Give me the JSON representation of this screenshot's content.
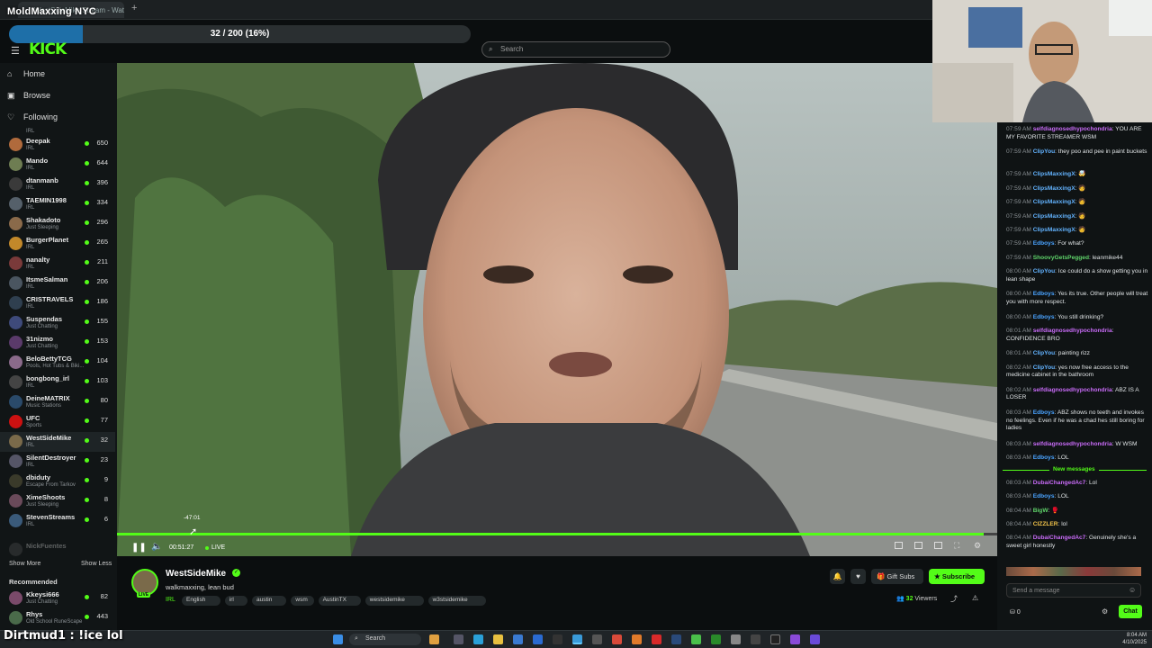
{
  "overlay": {
    "title": "MoldMaxxing NYC",
    "progress_text": "32 / 200 (16%)",
    "progress_fraction": 0.16,
    "caption": "Dirtmud1 : !ice lol"
  },
  "browser": {
    "tab_label": "WestSideMike Stream - Watc"
  },
  "header": {
    "logo": "KICK",
    "search_placeholder": "Search"
  },
  "sidebar": {
    "nav": [
      {
        "label": "Home",
        "icon": "home-icon"
      },
      {
        "label": "Browse",
        "icon": "browse-icon"
      },
      {
        "label": "Following",
        "icon": "heart-icon"
      }
    ],
    "top_partial_sub": "IRL",
    "following": [
      {
        "name": "Deepak",
        "sub": "IRL",
        "viewers": "650",
        "color": "#b06a3c"
      },
      {
        "name": "Mando",
        "sub": "IRL",
        "viewers": "644",
        "color": "#6e7d52"
      },
      {
        "name": "dtanmanb",
        "sub": "IRL",
        "viewers": "396",
        "color": "#3a3a3a"
      },
      {
        "name": "TAEMIN1998",
        "sub": "IRL",
        "viewers": "334",
        "color": "#55606a"
      },
      {
        "name": "Shakadoto",
        "sub": "Just Sleeping",
        "viewers": "296",
        "color": "#8a6a4a"
      },
      {
        "name": "BurgerPlanet",
        "sub": "IRL",
        "viewers": "265",
        "color": "#c2882a"
      },
      {
        "name": "nanalty",
        "sub": "IRL",
        "viewers": "211",
        "color": "#7a3a3a"
      },
      {
        "name": "ItsmeSalman",
        "sub": "IRL",
        "viewers": "206",
        "color": "#4a5560"
      },
      {
        "name": "CRISTRAVELS",
        "sub": "IRL",
        "viewers": "186",
        "color": "#2f3f4f"
      },
      {
        "name": "Suspendas",
        "sub": "Just Chatting",
        "viewers": "155",
        "color": "#3e4a7a"
      },
      {
        "name": "31nizmo",
        "sub": "Just Chatting",
        "viewers": "153",
        "color": "#5a3a6a"
      },
      {
        "name": "BeloBettyTCG",
        "sub": "Pools, Hot Tubs & Biki...",
        "viewers": "104",
        "color": "#8a6a8a"
      },
      {
        "name": "bongbong_irl",
        "sub": "IRL",
        "viewers": "103",
        "color": "#444"
      },
      {
        "name": "DeineMATRIX",
        "sub": "Music Stations",
        "viewers": "80",
        "color": "#2a4a6a"
      },
      {
        "name": "UFC",
        "sub": "Sports",
        "viewers": "77",
        "color": "#c11"
      },
      {
        "name": "WestSideMike",
        "sub": "IRL",
        "viewers": "32",
        "color": "#7a6a4a",
        "selected": true
      },
      {
        "name": "SilentDestroyer",
        "sub": "IRL",
        "viewers": "23",
        "color": "#556"
      },
      {
        "name": "dbiduty",
        "sub": "Escape From Tarkov",
        "viewers": "9",
        "color": "#3a3a2a"
      },
      {
        "name": "XimeShoots",
        "sub": "Just Sleeping",
        "viewers": "8",
        "color": "#6a4a5a"
      },
      {
        "name": "StevenStreams",
        "sub": "IRL",
        "viewers": "6",
        "color": "#3a5a7a"
      }
    ],
    "faded_channel": "NickFuentes",
    "show_more": "Show More",
    "show_less": "Show Less",
    "recommended_title": "Recommended",
    "recommended": [
      {
        "name": "Kkeysi666",
        "sub": "Just Chatting",
        "viewers": "82",
        "color": "#7a4a6a"
      },
      {
        "name": "Rhys",
        "sub": "Old School RuneScape",
        "viewers": "443",
        "color": "#4a6a4a"
      }
    ]
  },
  "player": {
    "hover_time": "-47:01",
    "elapsed": "00:51:27",
    "live_label": "LIVE",
    "played_fraction": 0.985,
    "icons": [
      "theater-icon",
      "miniplayer-icon",
      "clip-icon",
      "fullscreen-icon",
      "settings-icon"
    ]
  },
  "stream": {
    "channel": "WestSideMike",
    "title": "walkmaxxing, lean bud",
    "live_badge": "LIVE",
    "category": "IRL",
    "tags": [
      "English",
      "irl",
      "austin",
      "wsm",
      "AustinTX",
      "westsidemike",
      "w3stsidemike"
    ],
    "gift_label": "Gift Subs",
    "subscribe_label": "Subscribe",
    "viewers_count": "32",
    "viewers_label": "Viewers"
  },
  "chat": {
    "messages": [
      {
        "time": "07:59 AM",
        "user": "selfdiagnosedhypochondria",
        "text": "YOU ARE MY FAVORITE STREAMER WSM",
        "color": "#c86bf7",
        "lines": 2
      },
      {
        "time": "07:59 AM",
        "user": "ClipYou",
        "text": "they poo and pee in paint buckets",
        "color": "#63b3ff",
        "lines": 2
      },
      {
        "time": "07:59 AM",
        "user": "ClipsMaxxingX",
        "text": "🤯",
        "color": "#63b3ff",
        "lines": 1
      },
      {
        "time": "07:59 AM",
        "user": "ClipsMaxxingX",
        "text": "🧑",
        "color": "#63b3ff",
        "lines": 1
      },
      {
        "time": "07:59 AM",
        "user": "ClipsMaxxingX",
        "text": "🧑",
        "color": "#63b3ff",
        "lines": 1
      },
      {
        "time": "07:59 AM",
        "user": "ClipsMaxxingX",
        "text": "🧑",
        "color": "#63b3ff",
        "lines": 1
      },
      {
        "time": "07:59 AM",
        "user": "ClipsMaxxingX",
        "text": "🧑",
        "color": "#63b3ff",
        "lines": 1
      },
      {
        "time": "07:59 AM",
        "user": "Edboys",
        "text": "For what?",
        "color": "#4aa3ff",
        "lines": 1
      },
      {
        "time": "07:59 AM",
        "user": "ShoovyGetsPegged",
        "text": "leanmike44",
        "color": "#5fd36a",
        "lines": 1
      },
      {
        "time": "08:00 AM",
        "user": "ClipYou",
        "text": "Ice could do a show getting you in lean shape",
        "color": "#63b3ff",
        "lines": 2
      },
      {
        "time": "08:00 AM",
        "user": "Edboys",
        "text": "Yes its true. Other people will treat you with more respect.",
        "color": "#4aa3ff",
        "lines": 2
      },
      {
        "time": "08:00 AM",
        "user": "Edboys",
        "text": "You still drinking?",
        "color": "#4aa3ff",
        "lines": 1
      },
      {
        "time": "08:01 AM",
        "user": "selfdiagnosedhypochondria",
        "text": "CONFIDENCE BRO",
        "color": "#c86bf7",
        "lines": 2
      },
      {
        "time": "08:01 AM",
        "user": "ClipYou",
        "text": "painting rizz",
        "color": "#63b3ff",
        "lines": 1
      },
      {
        "time": "08:02 AM",
        "user": "ClipYou",
        "text": "yes now free access to the medicine cabinet in the bathroom",
        "color": "#63b3ff",
        "lines": 2
      },
      {
        "time": "08:02 AM",
        "user": "selfdiagnosedhypochondria",
        "text": "ABZ IS A LOSER",
        "color": "#c86bf7",
        "lines": 2
      },
      {
        "time": "08:03 AM",
        "user": "Edboys",
        "text": "ABZ shows no teeth and invokes no feelings. Even if he was a chad hes still boring for ladies",
        "color": "#4aa3ff",
        "lines": 3
      },
      {
        "time": "08:03 AM",
        "user": "selfdiagnosedhypochondria",
        "text": "W WSM",
        "color": "#c86bf7",
        "lines": 1
      },
      {
        "time": "08:03 AM",
        "user": "Edboys",
        "text": "LOL",
        "color": "#4aa3ff",
        "lines": 1
      }
    ],
    "new_messages_label": "New messages",
    "new": [
      {
        "time": "08:03 AM",
        "user": "DubaiChangedAc7",
        "text": "Lol",
        "color": "#c86bf7",
        "lines": 1
      },
      {
        "time": "08:03 AM",
        "user": "Edboys",
        "text": "LOL",
        "color": "#4aa3ff",
        "lines": 1
      },
      {
        "time": "08:04 AM",
        "user": "BigW",
        "text": "🥊",
        "color": "#5fd36a",
        "lines": 1
      },
      {
        "time": "08:04 AM",
        "user": "CIZZLER",
        "text": "lol",
        "color": "#f0c24a",
        "lines": 1
      },
      {
        "time": "08:04 AM",
        "user": "DubaiChangedAc7",
        "text": "Genuinely she's a sweet girl honestly",
        "color": "#c86bf7",
        "lines": 2
      }
    ],
    "input_placeholder": "Send a message",
    "points": "0",
    "chat_button": "Chat"
  },
  "taskbar": {
    "search_label": "Search",
    "time": "8:04 AM",
    "date": "4/10/2025"
  }
}
